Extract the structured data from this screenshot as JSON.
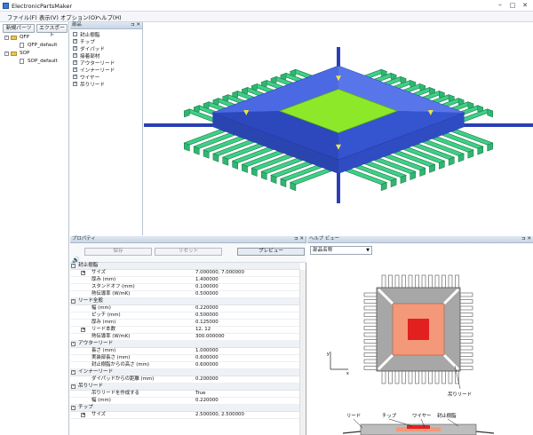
{
  "window": {
    "title": "ElectronicPartsMaker",
    "minimize": "–",
    "maximize": "□",
    "close": "✕"
  },
  "menu": [
    "ファイル(F)",
    "表示(V)",
    "オプション(O)",
    "ヘルプ(H)"
  ],
  "left": {
    "new_part_label": "新規パーツ",
    "export_label": "エクスポート",
    "tree": [
      {
        "label": "QFP",
        "children": [
          "QFP_default"
        ]
      },
      {
        "label": "SOP",
        "children": [
          "SOP_default"
        ]
      }
    ]
  },
  "parts": {
    "header": "部品",
    "pin": "⊐ ✕",
    "items": [
      {
        "label": "封止樹脂",
        "checked": false
      },
      {
        "label": "チップ",
        "checked": true
      },
      {
        "label": "ダイパッド",
        "checked": true
      },
      {
        "label": "接着部材",
        "checked": true
      },
      {
        "label": "アウターリード",
        "checked": true
      },
      {
        "label": "インナーリード",
        "checked": true
      },
      {
        "label": "ワイヤー",
        "checked": true
      },
      {
        "label": "吊りリード",
        "checked": true
      }
    ]
  },
  "properties": {
    "header": "プロパティ",
    "pin": "⊐ ✕",
    "save_label": "保存",
    "reset_label": "リセット",
    "preview_label": "プレビュー",
    "rows": [
      {
        "kind": "cat",
        "label": "封止樹脂"
      },
      {
        "kind": "row",
        "label": "サイズ",
        "value": "7.000000, 7.000000",
        "expand": true
      },
      {
        "kind": "row",
        "label": "厚み (mm)",
        "value": "1.400000"
      },
      {
        "kind": "row",
        "label": "スタンドオフ (mm)",
        "value": "0.100000"
      },
      {
        "kind": "row",
        "label": "熱伝導率 (W/mK)",
        "value": "0.500000"
      },
      {
        "kind": "cat",
        "label": "リード全般"
      },
      {
        "kind": "row",
        "label": "幅 (mm)",
        "value": "0.220000"
      },
      {
        "kind": "row",
        "label": "ピッチ (mm)",
        "value": "0.500000"
      },
      {
        "kind": "row",
        "label": "厚み (mm)",
        "value": "0.125000"
      },
      {
        "kind": "row",
        "label": "リード本数",
        "value": "12, 12",
        "expand": true
      },
      {
        "kind": "row",
        "label": "熱伝導率 (W/mK)",
        "value": "300.000000"
      },
      {
        "kind": "cat",
        "label": "アウターリード"
      },
      {
        "kind": "row",
        "label": "長さ (mm)",
        "value": "1.000000"
      },
      {
        "kind": "row",
        "label": "実装部長さ (mm)",
        "value": "0.600000"
      },
      {
        "kind": "row",
        "label": "封止樹脂からの高さ (mm)",
        "value": "0.600000"
      },
      {
        "kind": "cat",
        "label": "インナーリード"
      },
      {
        "kind": "row",
        "label": "ダイパッドからの距離 (mm)",
        "value": "0.200000"
      },
      {
        "kind": "cat",
        "label": "吊りリード"
      },
      {
        "kind": "row",
        "label": "吊りリードを作成する",
        "value": "True"
      },
      {
        "kind": "row",
        "label": "幅 (mm)",
        "value": "0.220000"
      },
      {
        "kind": "cat",
        "label": "チップ"
      },
      {
        "kind": "row",
        "label": "サイズ",
        "value": "2.500000, 2.500000",
        "expand": true
      }
    ]
  },
  "help": {
    "header": "ヘルプ ビュー",
    "pin": "⊐ ✕",
    "dropdown": "部品名称",
    "labels": {
      "hanging_lead": "吊りリード",
      "lead": "リード",
      "chip": "チップ",
      "wire": "ワイヤー",
      "resin": "封止樹脂",
      "axis_y": "y",
      "axis_x": "x"
    }
  },
  "colors": {
    "lead_green": "#3fcf86",
    "body_blue": "#3a5bd9",
    "die_green": "#8ee82a",
    "help_orange": "#f4987a",
    "help_red": "#e32020",
    "help_gray": "#a7a7a7"
  }
}
